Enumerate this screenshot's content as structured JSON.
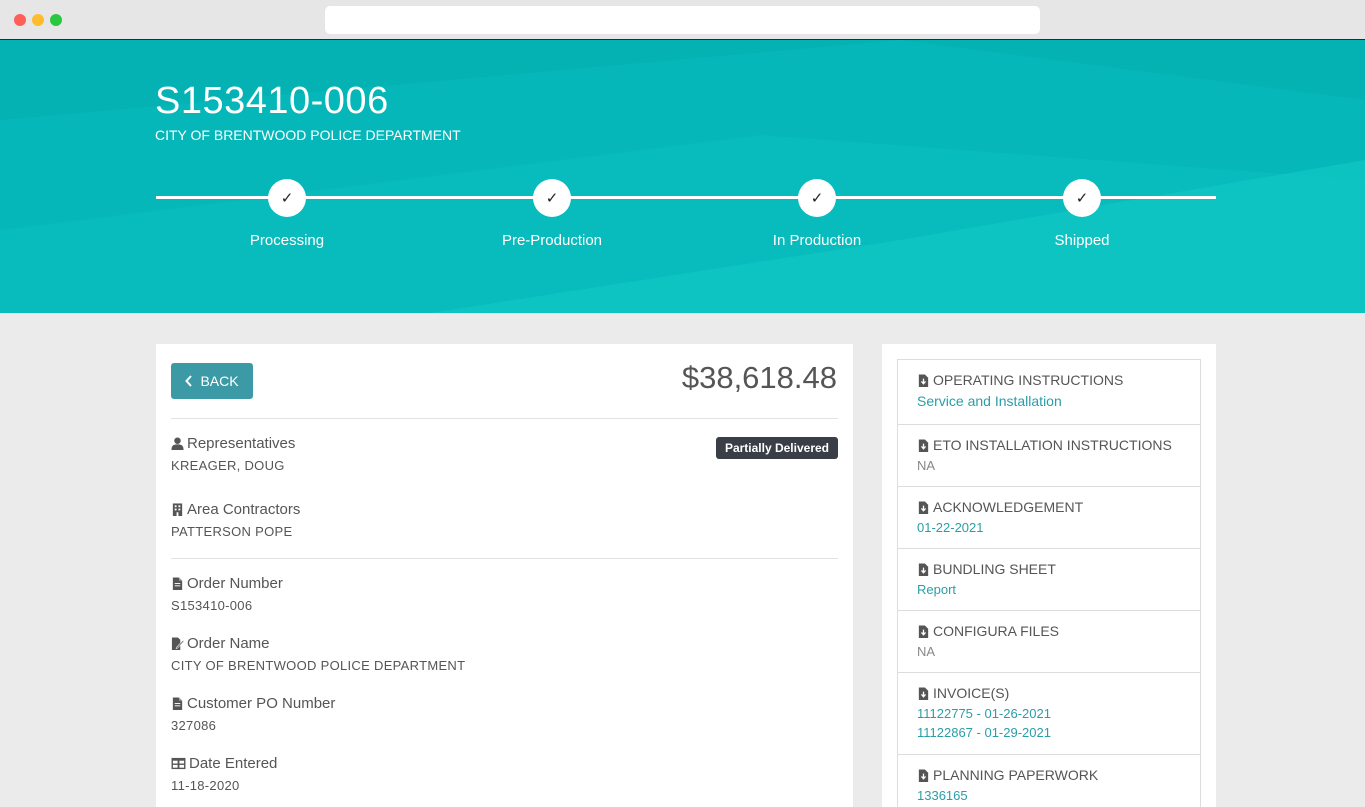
{
  "order": {
    "number": "S153410-006",
    "customer": "CITY OF BRENTWOOD POLICE DEPARTMENT",
    "total": "$38,618.48",
    "status": "Partially Delivered"
  },
  "progress": {
    "check": "✓",
    "steps": [
      {
        "label": "Processing"
      },
      {
        "label": "Pre-Production"
      },
      {
        "label": "In Production"
      },
      {
        "label": "Shipped"
      }
    ]
  },
  "actions": {
    "back_label": "BACK"
  },
  "fields": {
    "representatives": {
      "label": "Representatives",
      "value": "KREAGER, DOUG"
    },
    "area_contractors": {
      "label": "Area Contractors",
      "value": "PATTERSON POPE"
    },
    "order_number": {
      "label": "Order Number",
      "value": "S153410-006"
    },
    "order_name": {
      "label": "Order Name",
      "value": "CITY OF BRENTWOOD POLICE DEPARTMENT"
    },
    "customer_po": {
      "label": "Customer PO Number",
      "value": "327086"
    },
    "date_entered": {
      "label": "Date Entered",
      "value": "11-18-2020"
    }
  },
  "documents": [
    {
      "title": "OPERATING INSTRUCTIONS",
      "links": [
        "Service and Installation"
      ]
    },
    {
      "title": "ETO INSTALLATION INSTRUCTIONS",
      "value": "NA"
    },
    {
      "title": "ACKNOWLEDGEMENT",
      "links": [
        "01-22-2021"
      ]
    },
    {
      "title": "BUNDLING SHEET",
      "links": [
        "Report"
      ]
    },
    {
      "title": "CONFIGURA FILES",
      "value": "NA"
    },
    {
      "title": "INVOICE(S)",
      "links": [
        "11122775 - 01-26-2021",
        "11122867 - 01-29-2021"
      ]
    },
    {
      "title": "PLANNING PAPERWORK",
      "links": [
        "1336165"
      ]
    }
  ],
  "colors": {
    "hero": "#05b7b8",
    "accent": "#3b9aa6",
    "link": "#2a9ea8",
    "badge": "#3a3f47"
  },
  "icons": {
    "window_controls": [
      "close-dot",
      "minimize-dot",
      "zoom-dot"
    ],
    "back": "chevron-left-icon",
    "representatives": "user-icon",
    "area_contractors": "building-icon",
    "order_number": "file-icon",
    "order_name": "edit-file-icon",
    "customer_po": "file-icon",
    "date_entered": "table-icon",
    "documents": "file-download-icon"
  }
}
